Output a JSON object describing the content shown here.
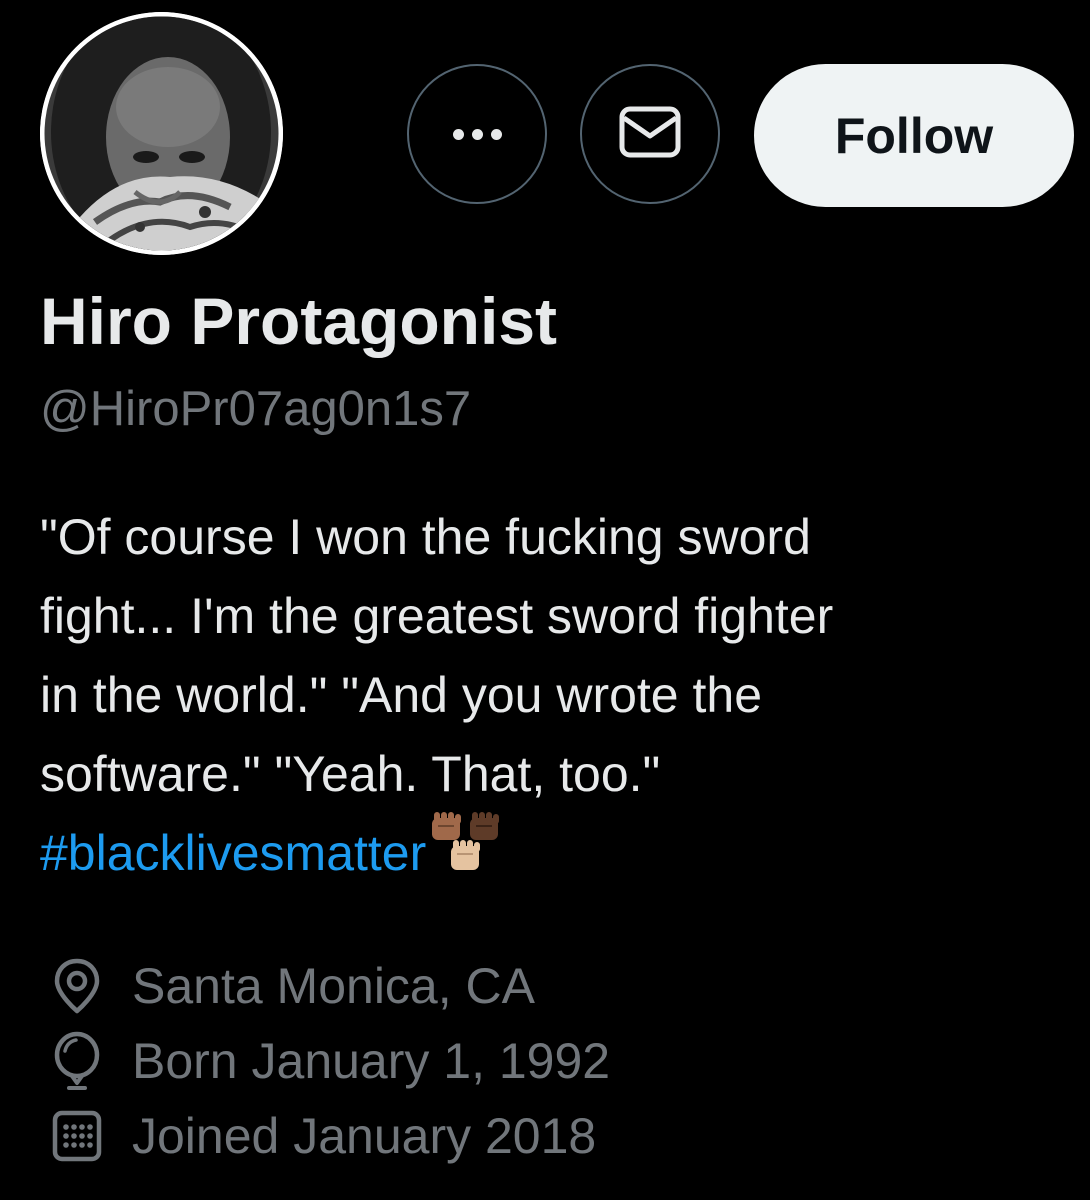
{
  "profile": {
    "display_name": "Hiro Protagonist",
    "handle": "@HiroPr07ag0n1s7",
    "avatar_icon": "avatar-photo"
  },
  "actions": {
    "more_icon": "more-horizontal-icon",
    "message_icon": "envelope-icon",
    "follow_label": "Follow"
  },
  "bio": {
    "lines": [
      "\"Of course I won the fucking sword",
      "fight... I'm the greatest sword fighter",
      "in the world.\" \"And you wrote the",
      "software.\" \"Yeah. That, too.\""
    ],
    "hashtag": "#blacklivesmatter",
    "emoji_icon": "raised-fist-emoji-icons"
  },
  "meta": {
    "location": "Santa Monica, CA",
    "birthday": "Born January 1, 1992",
    "joined": "Joined January 2018",
    "location_icon": "location-pin-icon",
    "birthday_icon": "balloon-icon",
    "joined_icon": "calendar-icon"
  },
  "colors": {
    "background": "#000000",
    "primary_text": "#e7e9ea",
    "secondary_text": "#71767b",
    "link": "#1d9bf0",
    "button_border": "#536471",
    "follow_bg": "#eff3f4",
    "follow_text": "#0f1419"
  }
}
